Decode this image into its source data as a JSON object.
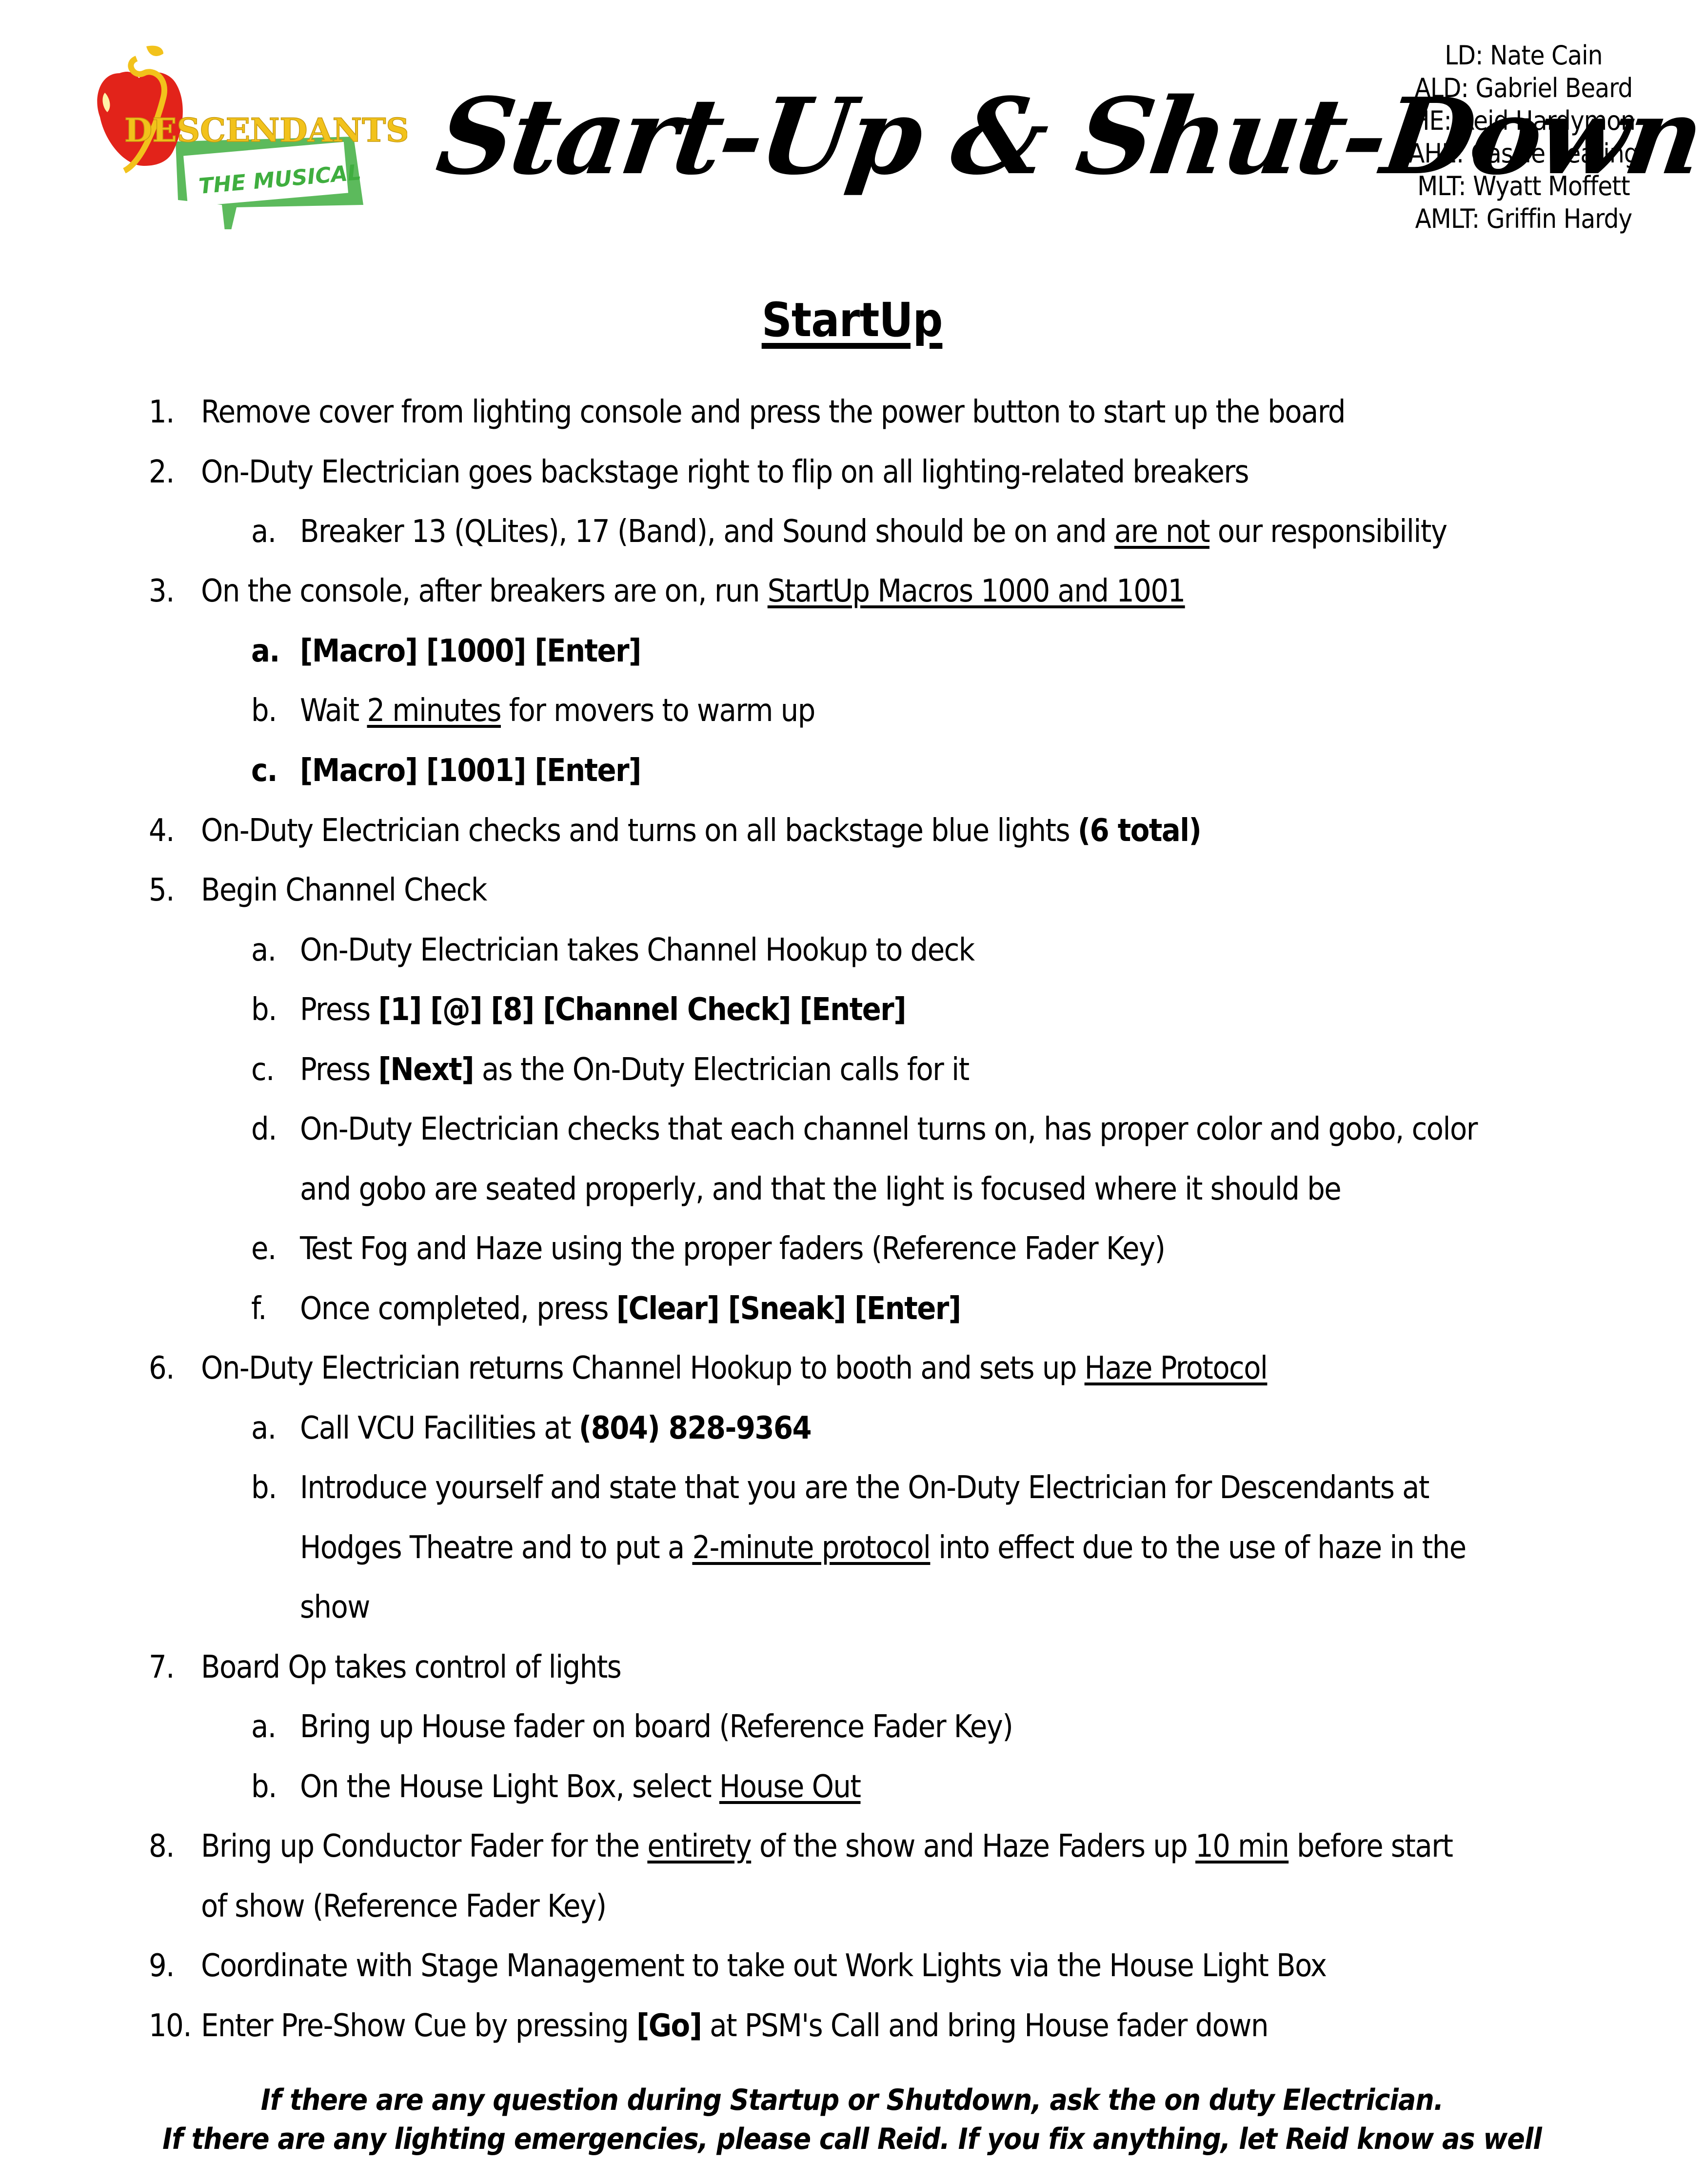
{
  "logo": {
    "brand": "DESCENDANTS",
    "subtitle": "THE MUSICAL",
    "colors": {
      "apple_red": "#e2231a",
      "gold": "#f2c21b",
      "green": "#3fae3f"
    }
  },
  "title": "Start-Up & Shut-Down",
  "credits": [
    "LD: Nate Cain",
    "ALD: Gabriel Beard",
    "HE: Reid Hardymon",
    "AHE: Cassie Keating",
    "MLT: Wyatt Moffett",
    "AMLT: Griffin Hardy"
  ],
  "section_heading": "StartUp",
  "steps": {
    "s1": {
      "num": "1.",
      "text": "Remove cover from lighting console and press the power button to start up the board"
    },
    "s2": {
      "num": "2.",
      "text": "On-Duty Electrician goes backstage right to flip on all lighting-related breakers"
    },
    "s2a": {
      "num": "a.",
      "pre": "Breaker 13 (QLites), 17 (Band), and Sound should be on and ",
      "u": "are not",
      "post": " our responsibility"
    },
    "s3": {
      "num": "3.",
      "pre": "On the console, after breakers are on, run ",
      "u": "StartUp Macros 1000 and 1001"
    },
    "s3a": {
      "num": "a.",
      "bold": "[Macro] [1000] [Enter]"
    },
    "s3b": {
      "num": "b.",
      "pre": "Wait ",
      "u": "2 minutes",
      "post": " for movers to warm up"
    },
    "s3c": {
      "num": "c.",
      "bold": "[Macro] [1001] [Enter]"
    },
    "s4": {
      "num": "4.",
      "pre": "On-Duty Electrician checks and turns on all backstage blue lights ",
      "bold": "(6 total)"
    },
    "s5": {
      "num": "5.",
      "text": "Begin Channel Check"
    },
    "s5a": {
      "num": "a.",
      "text": "On-Duty Electrician takes Channel Hookup to deck"
    },
    "s5b": {
      "num": "b.",
      "pre": "Press ",
      "bold": "[1] [@] [8] [Channel Check] [Enter]"
    },
    "s5c": {
      "num": "c.",
      "pre": "Press ",
      "bold": "[Next]",
      "post": " as the On-Duty Electrician calls for it"
    },
    "s5d": {
      "num": "d.",
      "text": "On-Duty Electrician checks that each channel turns on, has proper color and gobo, color",
      "cont": "and gobo are seated properly, and that the light is focused where it should be"
    },
    "s5e": {
      "num": "e.",
      "text": "Test Fog and Haze using the proper faders (Reference Fader Key)"
    },
    "s5f": {
      "num": "f.",
      "pre": "Once completed, press ",
      "bold": "[Clear] [Sneak] [Enter]"
    },
    "s6": {
      "num": "6.",
      "pre": "On-Duty Electrician returns Channel Hookup to booth and sets up ",
      "u": "Haze Protocol"
    },
    "s6a": {
      "num": "a.",
      "pre": "Call VCU Facilities at ",
      "bold": "(804) 828-9364"
    },
    "s6b": {
      "num": "b.",
      "text": "Introduce yourself and state that you are the On-Duty Electrician for Descendants at",
      "cont_pre": "Hodges Theatre and to put a ",
      "cont_u": "2-minute protocol",
      "cont_post": " into effect due to the use of haze in the",
      "cont2": "show"
    },
    "s7": {
      "num": "7.",
      "text": "Board Op takes control of lights"
    },
    "s7a": {
      "num": "a.",
      "text": "Bring up House fader on board (Reference Fader Key)"
    },
    "s7b": {
      "num": "b.",
      "pre": "On the House Light Box, select ",
      "u": "House Out"
    },
    "s8": {
      "num": "8.",
      "pre": "Bring up Conductor Fader for the ",
      "u1": "entirety",
      "mid": " of the show and Haze Faders up ",
      "u2": "10 min",
      "post": " before start",
      "cont": "of show (Reference Fader Key)"
    },
    "s9": {
      "num": "9.",
      "text": "Coordinate with Stage Management to take out Work Lights via the House Light Box"
    },
    "s10": {
      "num": "10.",
      "pre": "Enter Pre-Show Cue by pressing ",
      "bold": "[Go]",
      "post": " at PSM's Call and bring House fader down"
    }
  },
  "footer": {
    "line1": "If there are any question during Startup or Shutdown, ask the on duty Electrician.",
    "line2": "If there are any lighting emergencies, please call Reid. If you fix anything, let Reid know as well"
  }
}
